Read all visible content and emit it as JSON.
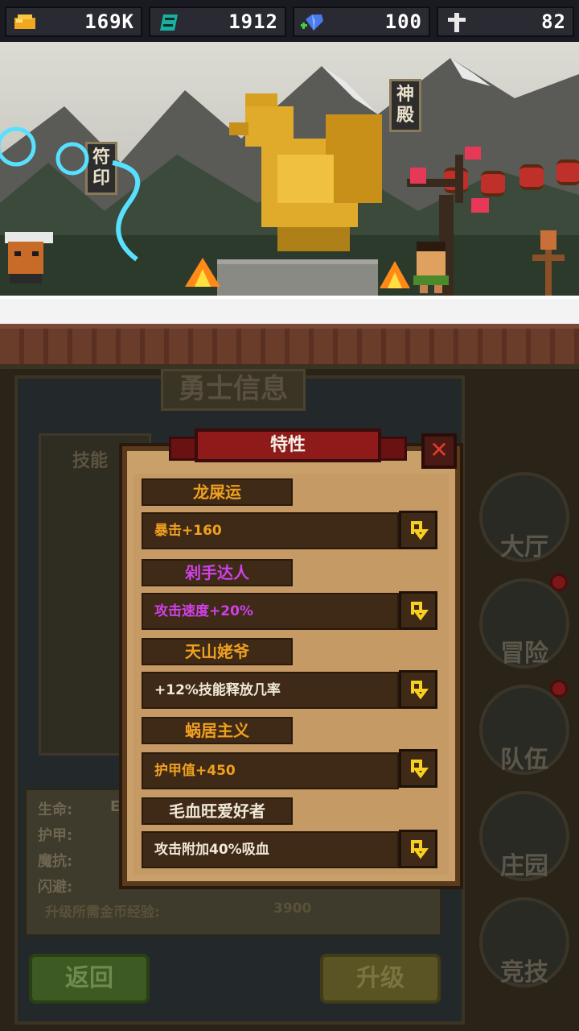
{
  "resources": [
    {
      "icon": "gold-coin-icon",
      "value": "169K"
    },
    {
      "icon": "green-gem-icon",
      "value": "1912"
    },
    {
      "icon": "blue-diamond-icon",
      "value": "100"
    },
    {
      "icon": "white-cross-icon",
      "value": "82"
    }
  ],
  "scene": {
    "sign_left": "符印",
    "sign_right": "神殿"
  },
  "panel": {
    "title": "勇士信息",
    "skill_label": "技能",
    "stats": [
      "生命:",
      "护甲:",
      "魔抗:",
      "闪避:"
    ],
    "stat_hp_partial": "E",
    "upgrade_cost_label": "升级所需金币经验:",
    "upgrade_cost_value": "3900",
    "back_button": "返回",
    "upgrade_button": "升级"
  },
  "nav": [
    {
      "label": "大厅",
      "badge": false
    },
    {
      "label": "冒险",
      "badge": true
    },
    {
      "label": "队伍",
      "badge": true
    },
    {
      "label": "庄园",
      "badge": false
    },
    {
      "label": "竞技",
      "badge": false
    }
  ],
  "dialog": {
    "title": "特性",
    "close_label": "✕",
    "traits": [
      {
        "name": "龙屎运",
        "desc": "暴击+160",
        "name_color": "#f0a020",
        "desc_color": "#f0a020"
      },
      {
        "name": "剁手达人",
        "desc": "攻击速度+20%",
        "name_color": "#d040e8",
        "desc_color": "#d040e8"
      },
      {
        "name": "天山姥爷",
        "desc": "+12%技能释放几率",
        "name_color": "#f0a020",
        "desc_color": "#f0e8d8"
      },
      {
        "name": "蜗居主义",
        "desc": "护甲值+450",
        "name_color": "#f0a020",
        "desc_color": "#f0a020"
      },
      {
        "name": "毛血旺爱好者",
        "desc": "攻击附加40%吸血",
        "name_color": "#f0e8d8",
        "desc_color": "#f0e8d8"
      }
    ]
  }
}
